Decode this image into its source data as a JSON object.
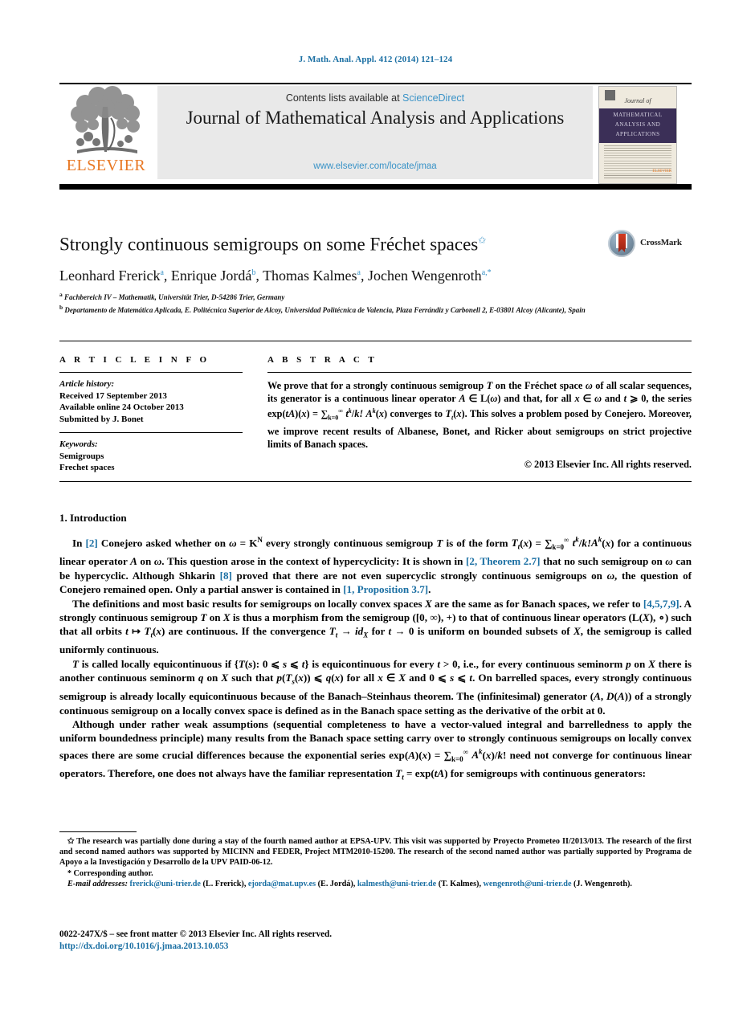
{
  "running_head": "J. Math. Anal. Appl. 412 (2014) 121–124",
  "masthead": {
    "contents_prefix": "Contents lists available at ",
    "sciencedirect": "ScienceDirect",
    "journal_title": "Journal of Mathematical Analysis and Applications",
    "journal_url": "www.elsevier.com/locate/jmaa",
    "publisher": "ELSEVIER",
    "cover": {
      "journal_of": "Journal of",
      "band_line1": "MATHEMATICAL",
      "band_line2": "ANALYSIS AND",
      "band_line3": "APPLICATIONS",
      "publisher_mark": "ELSEVIER"
    }
  },
  "article": {
    "title": "Strongly continuous semigroups on some Fréchet spaces",
    "title_footnote_mark": "✩",
    "authors": "Leonhard Frerick ᵃ, Enrique Jordá ᵇ, Thomas Kalmes ᵃ, Jochen Wengenroth ᵃ,*",
    "author_list": [
      {
        "name": "Leonhard Frerick",
        "marks": "a"
      },
      {
        "name": "Enrique Jordá",
        "marks": "b"
      },
      {
        "name": "Thomas Kalmes",
        "marks": "a"
      },
      {
        "name": "Jochen Wengenroth",
        "marks": "a,*"
      }
    ],
    "affiliations": [
      {
        "mark": "a",
        "text": "Fachbereich IV – Mathematik, Universität Trier, D-54286 Trier, Germany"
      },
      {
        "mark": "b",
        "text": "Departamento de Matemática Aplicada, E. Politécnica Superior de Alcoy, Universidad Politécnica de Valencia, Plaza Ferrándiz y Carbonell 2, E-03801 Alcoy (Alicante), Spain"
      }
    ],
    "crossmark_label": "CrossMark"
  },
  "article_info": {
    "heading": "A R T I C L E   I N F O",
    "history_label": "Article history:",
    "history": [
      "Received 17 September 2013",
      "Available online 24 October 2013",
      "Submitted by J. Bonet"
    ],
    "keywords_label": "Keywords:",
    "keywords": [
      "Semigroups",
      "Frechet spaces"
    ]
  },
  "abstract": {
    "heading": "A B S T R A C T",
    "text": "We prove that for a strongly continuous semigroup T on the Fréchet space ω of all scalar sequences, its generator is a continuous linear operator A ∈ L(ω) and that, for all x ∈ ω and t ⩾ 0, the series exp(tA)(x) = ∑∞k=0 tᵏ/k! Aᵏ(x) converges to Tt(x). This solves a problem posed by Conejero. Moreover, we improve recent results of Albanese, Bonet, and Ricker about semigroups on strict projective limits of Banach spaces.",
    "copyright": "© 2013 Elsevier Inc. All rights reserved."
  },
  "body": {
    "section1_heading": "1. Introduction",
    "paragraphs": [
      "In [2] Conejero asked whether on ω = K^N every strongly continuous semigroup T is of the form Tt(x) = ∑∞k=0 tᵏ/k! Aᵏ(x) for a continuous linear operator A on ω. This question arose in the context of hypercyclicity: It is shown in [2, Theorem 2.7] that no such semigroup on ω can be hypercyclic. Although Shkarin [8] proved that there are not even supercyclic strongly continuous semigroups on ω, the question of Conejero remained open. Only a partial answer is contained in [1, Proposition 3.7].",
      "The definitions and most basic results for semigroups on locally convex spaces X are the same as for Banach spaces, we refer to [4,5,7,9]. A strongly continuous semigroup T on X is thus a morphism from the semigroup ([0, ∞), +) to that of continuous linear operators (L(X), ∘) such that all orbits t ↦ Tt(x) are continuous. If the convergence Tt → idX for t → 0 is uniform on bounded subsets of X, the semigroup is called uniformly continuous.",
      "T is called locally equicontinuous if {T(s): 0 ⩽ s ⩽ t} is equicontinuous for every t > 0, i.e., for every continuous seminorm p on X there is another continuous seminorm q on X such that p(Ts(x)) ⩽ q(x) for all x ∈ X and 0 ⩽ s ⩽ t. On barrelled spaces, every strongly continuous semigroup is already locally equicontinuous because of the Banach–Steinhaus theorem. The (infinitesimal) generator (A, D(A)) of a strongly continuous semigroup on a locally convex space is defined as in the Banach space setting as the derivative of the orbit at 0.",
      "Although under rather weak assumptions (sequential completeness to have a vector-valued integral and barrelledness to apply the uniform boundedness principle) many results from the Banach space setting carry over to strongly continuous semigroups on locally convex spaces there are some crucial differences because the exponential series exp(A)(x) = ∑∞k=0 Aᵏ(x)/k! need not converge for continuous linear operators. Therefore, one does not always have the familiar representation Tt = exp(tA) for semigroups with continuous generators:"
    ]
  },
  "footnotes": {
    "star_mark": "✩",
    "star_text": "The research was partially done during a stay of the fourth named author at EPSA-UPV. This visit was supported by Proyecto Prometeo II/2013/013. The research of the first and second named authors was supported by MICINN and FEDER, Project MTM2010-15200. The research of the second named author was partially supported by Programa de Apoyo a la Investigación y Desarrollo de la UPV PAID-06-12.",
    "corresponding_mark": "*",
    "corresponding_text": "Corresponding author.",
    "email_label": "E-mail addresses:",
    "emails": [
      {
        "address": "frerick@uni-trier.de",
        "who": "(L. Frerick)"
      },
      {
        "address": "ejorda@mat.upv.es",
        "who": "(E. Jordá)"
      },
      {
        "address": "kalmesth@uni-trier.de",
        "who": "(T. Kalmes)"
      },
      {
        "address": "wengenroth@uni-trier.de",
        "who": "(J. Wengenroth)"
      }
    ]
  },
  "colophon": {
    "issn_line": "0022-247X/$ – see front matter © 2013 Elsevier Inc. All rights reserved.",
    "doi": "http://dx.doi.org/10.1016/j.jmaa.2013.10.053"
  },
  "colors": {
    "link": "#1a6fa3",
    "sciencedirect": "#3a93c7",
    "elsevier_orange": "#E87722",
    "cover_band": "#3b2f57"
  }
}
